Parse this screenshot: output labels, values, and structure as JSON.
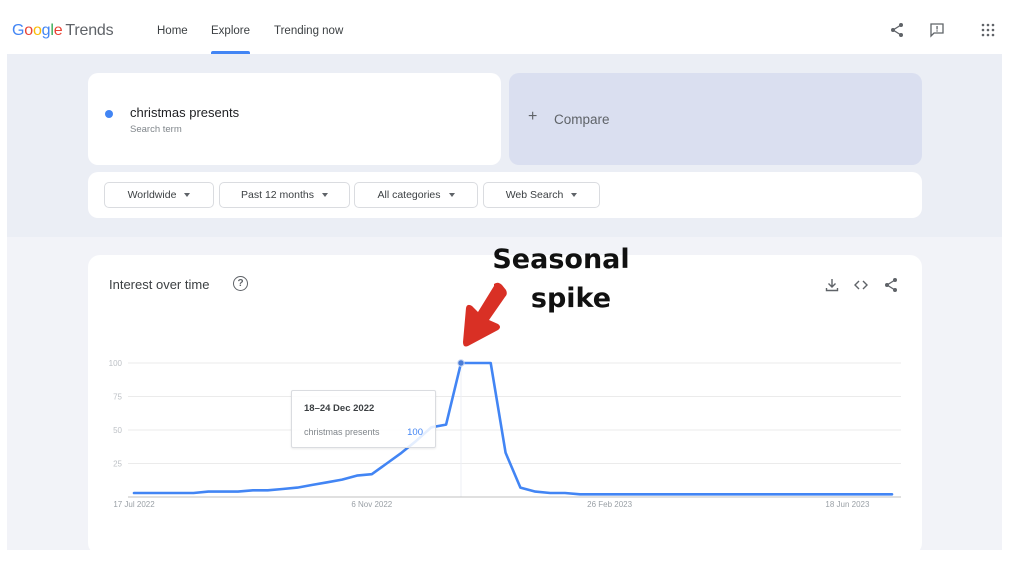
{
  "app": {
    "logo_google": [
      "G",
      "o",
      "o",
      "g",
      "l",
      "e"
    ],
    "logo_product": "Trends"
  },
  "nav": {
    "items": [
      {
        "label": "Home",
        "active": false
      },
      {
        "label": "Explore",
        "active": true
      },
      {
        "label": "Trending now",
        "active": false
      }
    ],
    "icons": [
      "share-icon",
      "feedback-icon",
      "apps-grid-icon"
    ]
  },
  "search": {
    "term": "christmas presents",
    "term_type": "Search term",
    "term_color": "#4285f4",
    "compare_label": "Compare",
    "compare_icon": "+"
  },
  "filters": [
    {
      "label": "Worldwide"
    },
    {
      "label": "Past 12 months"
    },
    {
      "label": "All categories"
    },
    {
      "label": "Web Search"
    }
  ],
  "interest_card": {
    "title": "Interest over time",
    "help_icon": "?",
    "actions": [
      "download-icon",
      "embed-icon",
      "share-icon"
    ]
  },
  "tooltip": {
    "date": "18–24 Dec 2022",
    "term": "christmas presents",
    "value": "100"
  },
  "annotation": {
    "line1": "Seasonal",
    "line2": "spike",
    "arrow_color": "#d93025"
  },
  "chart_data": {
    "type": "line",
    "title": "Interest over time",
    "xlabel": "",
    "ylabel": "",
    "ylim": [
      0,
      100
    ],
    "yticks": [
      25,
      50,
      75,
      100
    ],
    "xtick_labels": [
      "17 Jul 2022",
      "6 Nov 2022",
      "26 Feb 2023",
      "18 Jun 2023"
    ],
    "xtick_week_index": [
      0,
      16,
      32,
      48
    ],
    "grid": true,
    "legend": "none",
    "highlighted_point": {
      "week_index": 22,
      "label": "18–24 Dec 2022",
      "value": 100
    },
    "series": [
      {
        "name": "christmas presents",
        "color": "#4285f4",
        "values": [
          3,
          3,
          3,
          3,
          3,
          4,
          4,
          4,
          5,
          5,
          6,
          7,
          9,
          11,
          13,
          16,
          17,
          25,
          33,
          42,
          52,
          54,
          100,
          100,
          100,
          33,
          7,
          4,
          3,
          3,
          2,
          2,
          2,
          2,
          2,
          2,
          2,
          2,
          2,
          2,
          2,
          2,
          2,
          2,
          2,
          2,
          2,
          2,
          2,
          2,
          2,
          2
        ]
      }
    ]
  }
}
